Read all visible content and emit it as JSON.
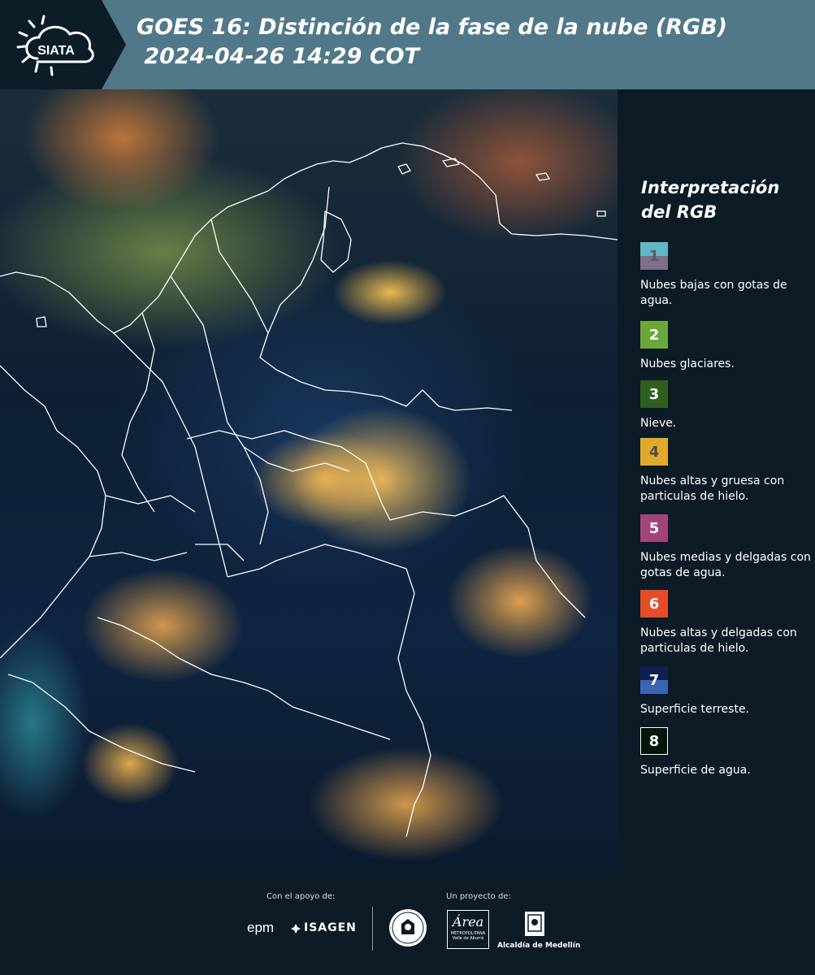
{
  "header": {
    "logo_text": "SIATA",
    "title_line1": "GOES 16: Distinción de la fase de la nube (RGB)",
    "title_line2": " 2024-04-26 14:29 COT"
  },
  "legend": {
    "title_line1": "Interpretación",
    "title_line2": "del RGB",
    "items": [
      {
        "num": "1",
        "label": "Nubes bajas con gotas de agua.",
        "color_top": "#63b7c5",
        "color_bottom": "#806e8b"
      },
      {
        "num": "2",
        "label": "Nubes glaciares.",
        "color_top": "#6aa83b",
        "color_bottom": "#6aa83b"
      },
      {
        "num": "3",
        "label": "Nieve.",
        "color_top": "#2e5f1f",
        "color_bottom": "#2e5f1f"
      },
      {
        "num": "4",
        "label": "Nubes altas y gruesa con particulas de hielo.",
        "color_top": "#e0ab2a",
        "color_bottom": "#e0ab2a"
      },
      {
        "num": "5",
        "label": "Nubes medias y delgadas con gotas de agua.",
        "color_top": "#a2447a",
        "color_bottom": "#a2447a"
      },
      {
        "num": "6",
        "label": "Nubes altas y delgadas con particulas de hielo.",
        "color_top": "#e44c2a",
        "color_bottom": "#e44c2a"
      },
      {
        "num": "7",
        "label": "Superficie terreste.",
        "color_top": "#0f2050",
        "color_bottom": "#3c64b4"
      },
      {
        "num": "8",
        "label": "Superficie de agua.",
        "color_top": "#04150a",
        "color_bottom": "#04150a"
      }
    ]
  },
  "footer": {
    "support_label": "Con el apoyo de:",
    "project_label": "Un proyecto de:",
    "epm": "epm",
    "isagen": "ISAGEN",
    "area_script": "Área",
    "area_line1": "METROPOLITANA",
    "area_line2": "Valle de Aburrá",
    "alcaldia": "Alcaldía de Medellín"
  }
}
